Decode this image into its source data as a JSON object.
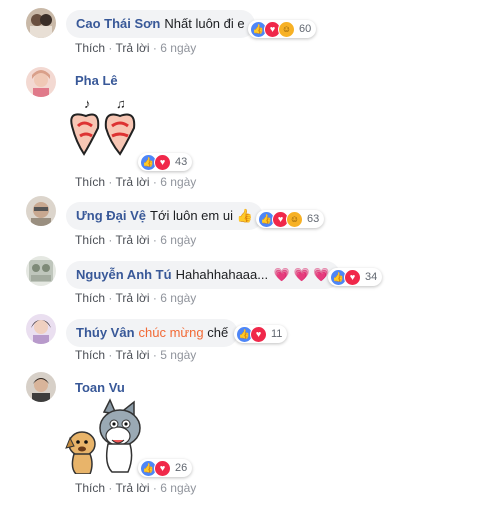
{
  "actions": {
    "like": "Thích",
    "reply": "Trả lời",
    "sep": "·"
  },
  "comments": [
    {
      "name": "Cao Thái Sơn",
      "text": "Nhất luôn đi e",
      "time": "6 ngày",
      "reactions": [
        "like-icon",
        "love-icon",
        "haha-icon"
      ],
      "count": "60"
    },
    {
      "name": "Pha Lê",
      "text": "",
      "time": "6 ngày",
      "reactions": [
        "like-icon",
        "love-icon"
      ],
      "count": "43",
      "sticker": "hearts-sticker"
    },
    {
      "name": "Ưng Đại Vệ",
      "text": "Tới luôn em ui",
      "emoji": "👍",
      "time": "6 ngày",
      "reactions": [
        "like-icon",
        "love-icon",
        "haha-icon"
      ],
      "count": "63"
    },
    {
      "name": "Nguyễn Anh Tú",
      "text": "Hahahhahaaa...",
      "emoji": "💗 💗 💗",
      "time": "6 ngày",
      "reactions": [
        "like-icon",
        "love-icon"
      ],
      "count": "34"
    },
    {
      "name": "Thúy Vân",
      "text_highlight": "chúc mừng",
      "text": "chế",
      "time": "5 ngày",
      "reactions": [
        "like-icon",
        "love-icon"
      ],
      "count": "11"
    },
    {
      "name": "Toan Vu",
      "text": "",
      "time": "6 ngày",
      "reactions": [
        "like-icon",
        "love-icon"
      ],
      "count": "26",
      "sticker": "cat-dog-sticker"
    }
  ],
  "colors": {
    "name": "#385898",
    "bubble": "#f2f3f5",
    "meta": "#90949c",
    "highlight": "#f26a36",
    "like": "#4e86f7",
    "love": "#f0284a",
    "haha": "#f7b125"
  }
}
